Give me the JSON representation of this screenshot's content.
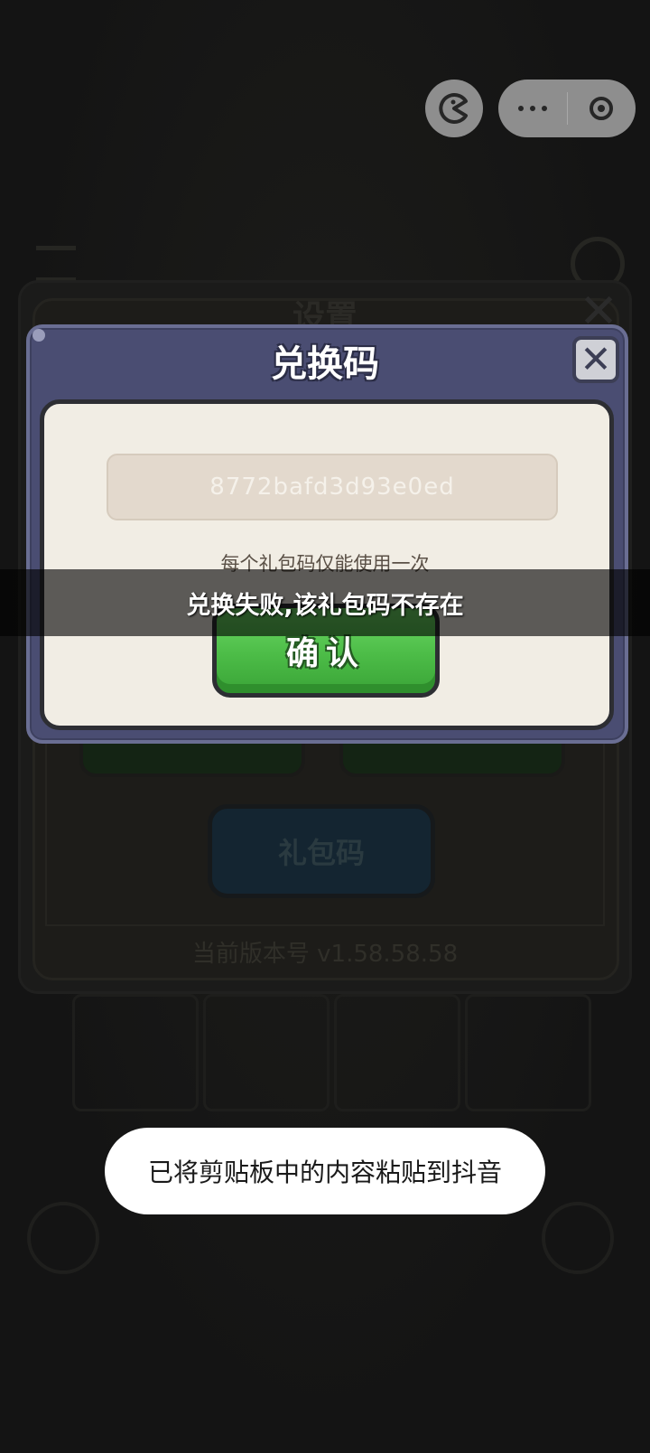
{
  "capsule": {
    "game_icon": "game-pacman-icon",
    "more_icon": "more-dots-icon",
    "close_icon": "target-circle-icon"
  },
  "background": {
    "settings_title": "设置",
    "gift_button_label": "礼包码",
    "version_text": "当前版本号 v1.58.58.58"
  },
  "dialog": {
    "title": "兑换码",
    "close_icon": "close-x-icon",
    "code_value": "8772bafd3d93e0ed",
    "hint": "每个礼包码仅能使用一次",
    "confirm_label": "确认"
  },
  "error_message": "兑换失败,该礼包码不存在",
  "toast": "已将剪贴板中的内容粘贴到抖音",
  "colors": {
    "dialog_frame": "#4a4d72",
    "dialog_body": "#f1ede4",
    "confirm_green": "#4cbc47",
    "input_bg": "#e3d9cd"
  }
}
